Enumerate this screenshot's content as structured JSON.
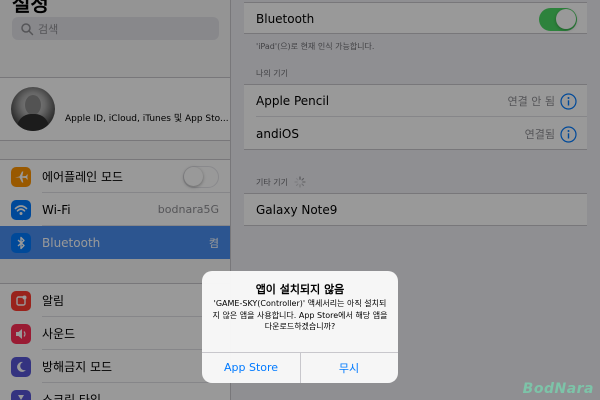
{
  "sidebar": {
    "title": "설정",
    "search_placeholder": "검색",
    "profile": {
      "text": "Apple ID, iCloud, iTunes 및 App Sto..."
    },
    "network_items": [
      {
        "label": "에어플레인 모드",
        "icon": "airplane-icon",
        "icon_color": "#ff9500",
        "value": "",
        "toggle": "off"
      },
      {
        "label": "Wi-Fi",
        "icon": "wifi-icon",
        "icon_color": "#007aff",
        "value": "bodnara5G"
      },
      {
        "label": "Bluetooth",
        "icon": "bluetooth-icon",
        "icon_color": "#007aff",
        "value": "켬",
        "selected": true
      }
    ],
    "notification_items": [
      {
        "label": "알림",
        "icon": "notifications-icon",
        "icon_color": "#ff3b30"
      },
      {
        "label": "사운드",
        "icon": "sound-icon",
        "icon_color": "#ff2d55"
      },
      {
        "label": "방해금지 모드",
        "icon": "moon-icon",
        "icon_color": "#5856d6"
      },
      {
        "label": "스크린 타임",
        "icon": "hourglass-icon",
        "icon_color": "#5856d6"
      }
    ]
  },
  "detail": {
    "bluetooth_label": "Bluetooth",
    "bluetooth_on": true,
    "discoverable_note": "'iPad'(으)로 현재 인식 가능합니다.",
    "my_devices_header": "나의 기기",
    "my_devices": [
      {
        "name": "Apple Pencil",
        "status": "연결 안 됨"
      },
      {
        "name": "andiOS",
        "status": "연결됨"
      }
    ],
    "other_devices_header": "기타 기기",
    "other_devices": [
      {
        "name": "Galaxy Note9"
      }
    ]
  },
  "alert": {
    "title": "앱이 설치되지 않음",
    "message": "'GAME-SKY(Controller)' 액세서리는 아직 설치되지 않은 앱을 사용합니다. App Store에서 해당 앱을 다운로드하겠습니까?",
    "buttons": [
      "App Store",
      "무시"
    ]
  },
  "watermark": "BodNara",
  "colors": {
    "accent": "#007aff",
    "selection": "#4a8ef0",
    "toggle_on": "#4cd964"
  }
}
